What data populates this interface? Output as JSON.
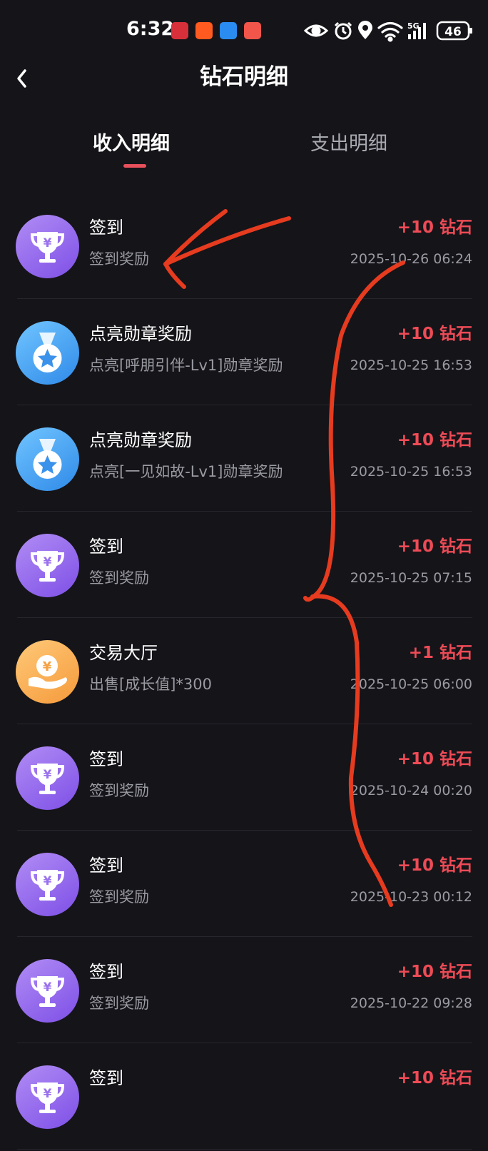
{
  "status_bar": {
    "time": "6:32",
    "network": "5G",
    "battery": "46",
    "icons": [
      "eye-icon",
      "alarm-icon",
      "location-icon",
      "wifi-icon",
      "signal-icon",
      "battery-icon"
    ]
  },
  "header": {
    "title": "钻石明细",
    "back_icon": "chevron-left-icon"
  },
  "tabs": [
    {
      "label": "收入明细",
      "active": true
    },
    {
      "label": "支出明细",
      "active": false
    }
  ],
  "colors": {
    "background": "#151419",
    "accent": "#e8505b",
    "amount": "#ee4b56"
  },
  "records": [
    {
      "icon": "trophy-icon",
      "title": "签到",
      "desc": "签到奖励",
      "amount": "+10 钻石",
      "date": "2025-10-26 06:24"
    },
    {
      "icon": "medal-icon",
      "title": "点亮勋章奖励",
      "desc": "点亮[呼朋引伴-Lv1]勋章奖励",
      "amount": "+10 钻石",
      "date": "2025-10-25 16:53"
    },
    {
      "icon": "medal-icon",
      "title": "点亮勋章奖励",
      "desc": "点亮[一见如故-Lv1]勋章奖励",
      "amount": "+10 钻石",
      "date": "2025-10-25 16:53"
    },
    {
      "icon": "trophy-icon",
      "title": "签到",
      "desc": "签到奖励",
      "amount": "+10 钻石",
      "date": "2025-10-25 07:15"
    },
    {
      "icon": "hand-coin-icon",
      "title": "交易大厅",
      "desc": "出售[成长值]*300",
      "amount": "+1 钻石",
      "date": "2025-10-25 06:00"
    },
    {
      "icon": "trophy-icon",
      "title": "签到",
      "desc": "签到奖励",
      "amount": "+10 钻石",
      "date": "2025-10-24 00:20"
    },
    {
      "icon": "trophy-icon",
      "title": "签到",
      "desc": "签到奖励",
      "amount": "+10 钻石",
      "date": "2025-10-23 00:12"
    },
    {
      "icon": "trophy-icon",
      "title": "签到",
      "desc": "签到奖励",
      "amount": "+10 钻石",
      "date": "2025-10-22 09:28"
    },
    {
      "icon": "trophy-icon",
      "title": "签到",
      "desc": "",
      "amount": "+10 钻石",
      "date": ""
    }
  ]
}
